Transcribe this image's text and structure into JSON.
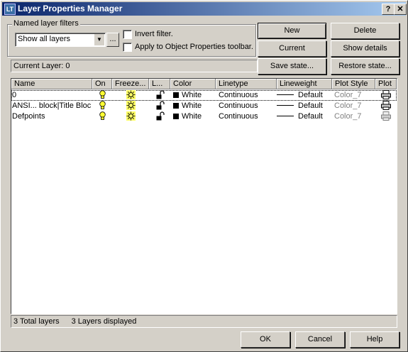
{
  "window": {
    "title": "Layer Properties Manager",
    "help_btn": "?",
    "close_btn": "✕"
  },
  "filters": {
    "group_label": "Named layer filters",
    "selected": "Show all layers",
    "dots": "...",
    "invert": "Invert filter.",
    "apply": "Apply to Object Properties toolbar."
  },
  "buttons": {
    "new": "New",
    "delete": "Delete",
    "current": "Current",
    "show_details": "Show details",
    "save_state": "Save state...",
    "restore_state": "Restore state...",
    "ok": "OK",
    "cancel": "Cancel",
    "help": "Help"
  },
  "current_layer": "Current Layer:  0",
  "columns": [
    "Name",
    "On",
    "Freeze...",
    "L...",
    "Color",
    "Linetype",
    "Lineweight",
    "Plot Style",
    "Plot"
  ],
  "layers": [
    {
      "name": "0",
      "color": "White",
      "linetype": "Continuous",
      "lineweight": "Default",
      "plot_style": "Color_7"
    },
    {
      "name": "ANSI... block|Title Block",
      "color": "White",
      "linetype": "Continuous",
      "lineweight": "Default",
      "plot_style": "Color_7"
    },
    {
      "name": "Defpoints",
      "color": "White",
      "linetype": "Continuous",
      "lineweight": "Default",
      "plot_style": "Color_7"
    }
  ],
  "status": {
    "total": "3 Total layers",
    "displayed": "3 Layers displayed"
  },
  "icons": {
    "on": "lightbulb-icon",
    "freeze": "sun-icon",
    "lock": "unlocked-padlock-icon",
    "plot": "printer-icon",
    "app": "layer-manager-app-icon"
  }
}
